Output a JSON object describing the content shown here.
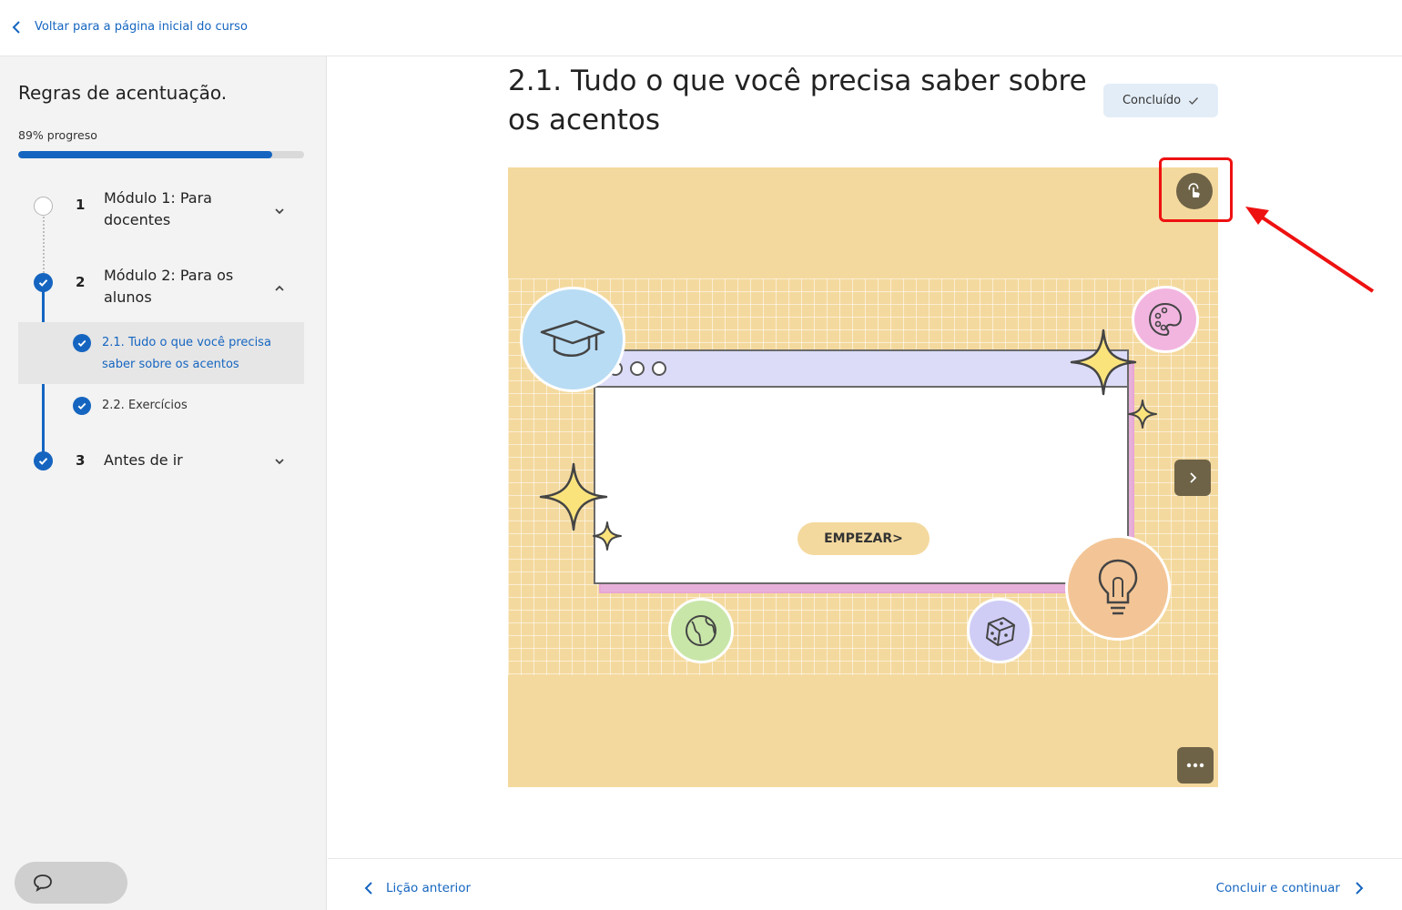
{
  "header": {
    "back_label": "Voltar para a página inicial do curso"
  },
  "sidebar": {
    "course_title": "Regras de acentuação.",
    "progress_label": "89% progreso",
    "progress": 0.89,
    "modules": [
      {
        "num": "1",
        "title": "Módulo 1: Para docentes",
        "status": "not-started",
        "expanded": false
      },
      {
        "num": "2",
        "title": "Módulo 2: Para os alunos",
        "status": "completed",
        "expanded": true
      },
      {
        "num": "3",
        "title": "Antes de ir",
        "status": "completed",
        "expanded": false
      }
    ],
    "lessons": [
      {
        "title": "2.1. Tudo o que você precisa saber sobre os acentos",
        "active": true
      },
      {
        "title": "2.2. Exercícios",
        "active": false
      }
    ]
  },
  "main": {
    "lesson_title": "2.1. Tudo o que você precisa saber sobre os acentos",
    "status_badge": "Concluído",
    "start_button": "EMPEZAR>"
  },
  "footer": {
    "prev_label": "Lição anterior",
    "next_label": "Concluir e continuar"
  },
  "colors": {
    "accent": "#1565c0",
    "stage_background": "#f4d99e",
    "annotation": "#e11111"
  }
}
